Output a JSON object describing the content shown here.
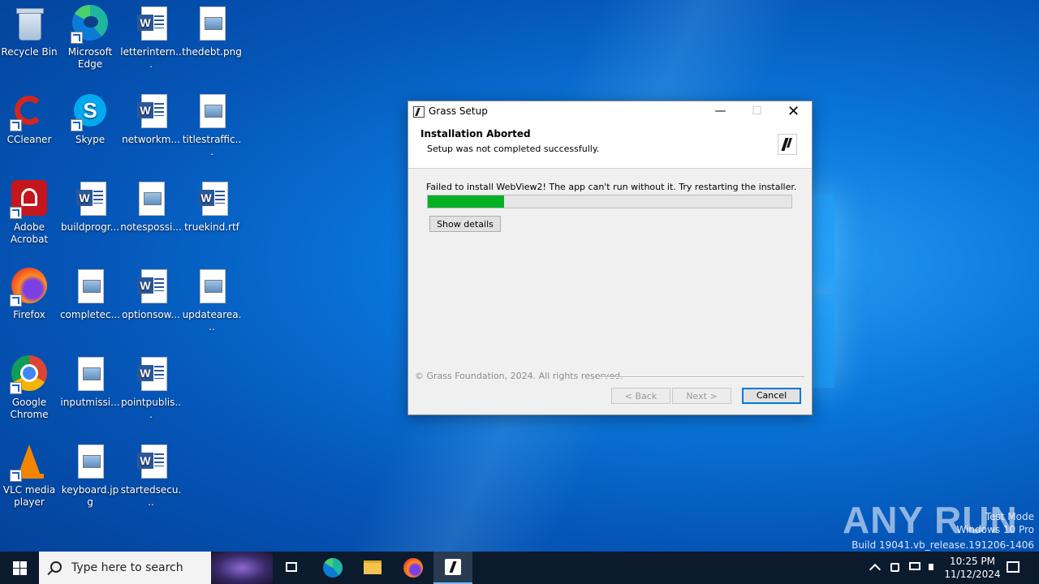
{
  "desktop": {
    "icons": [
      {
        "label": "Recycle Bin"
      },
      {
        "label": "Microsoft Edge"
      },
      {
        "label": "letterintern..."
      },
      {
        "label": "thedebt.png"
      },
      {
        "label": "CCleaner"
      },
      {
        "label": "Skype"
      },
      {
        "label": "networkm..."
      },
      {
        "label": "titlestraffic..."
      },
      {
        "label": "Adobe Acrobat"
      },
      {
        "label": "buildprogr..."
      },
      {
        "label": "notespossi..."
      },
      {
        "label": "truekind.rtf"
      },
      {
        "label": "Firefox"
      },
      {
        "label": "completec..."
      },
      {
        "label": "optionsow..."
      },
      {
        "label": "updatearea..."
      },
      {
        "label": "Google Chrome"
      },
      {
        "label": "inputmissi..."
      },
      {
        "label": "pointpublis..."
      },
      {
        "label": "VLC media player"
      },
      {
        "label": "keyboard.jpg"
      },
      {
        "label": "startedsecu..."
      }
    ]
  },
  "dialog": {
    "title": "Grass Setup",
    "header_title": "Installation Aborted",
    "header_subtitle": "Setup was not completed successfully.",
    "message": "Failed to install WebView2! The app can't run without it. Try restarting the installer.",
    "progress": 0.21,
    "show_details_label": "Show details",
    "footer": "© Grass Foundation, 2024. All rights reserved.",
    "back_label": "< Back",
    "next_label": "Next >",
    "cancel_label": "Cancel",
    "minimize_glyph": "—",
    "maximize_glyph": "☐",
    "close_glyph": "✕"
  },
  "watermark": {
    "brand": "ANY RUN",
    "mode": "Test Mode",
    "edition": "Windows 10 Pro",
    "build": "Build 19041.vb_release.191206-1406"
  },
  "taskbar": {
    "search_placeholder": "Type here to search",
    "time": "10:25 PM",
    "date": "11/12/2024",
    "accent": "#0078d7"
  }
}
